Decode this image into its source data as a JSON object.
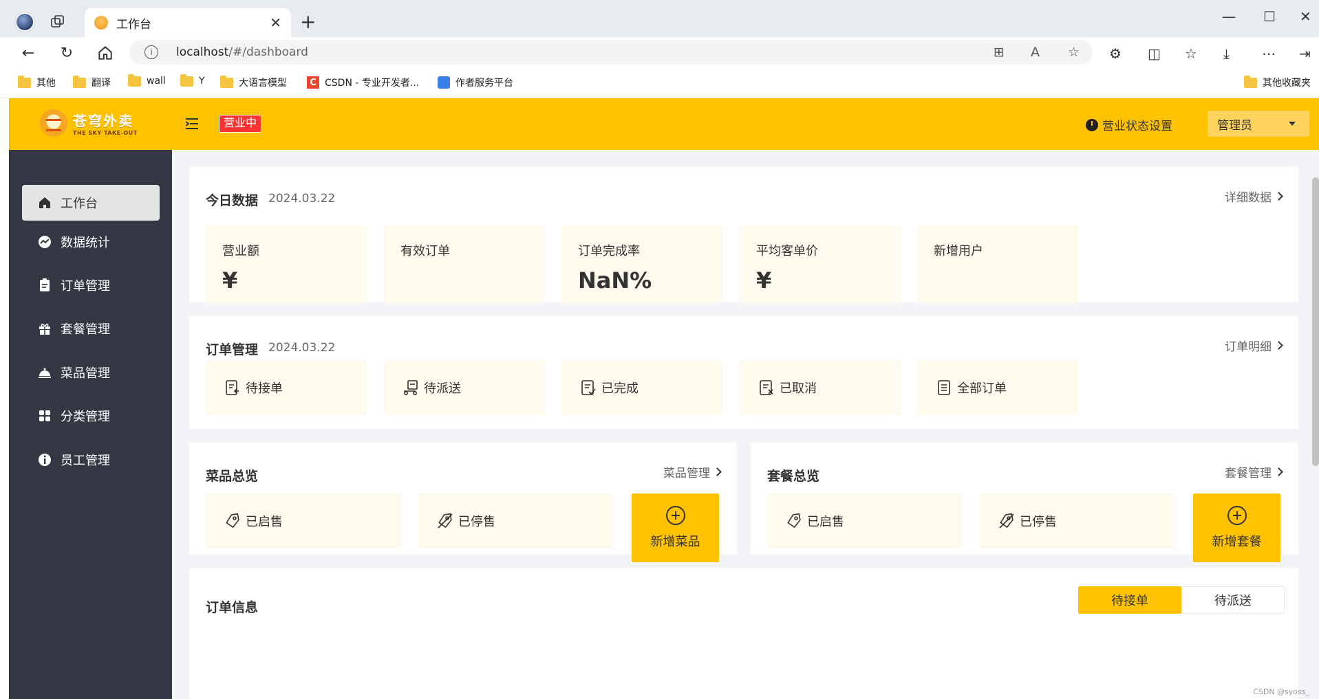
{
  "browser": {
    "tab_title": "工作台",
    "url_host": "localhost",
    "url_path": "/#/dashboard",
    "bookmarks": [
      "其他",
      "翻译",
      "wall",
      "Y",
      "大语言模型",
      "CSDN - 专业开发者...",
      "作者服务平台"
    ],
    "other_bookmarks": "其他收藏夹"
  },
  "header": {
    "logo_cn": "苍穹外卖",
    "logo_en": "THE SKY TAKE-OUT",
    "status_badge": "营业中",
    "status_settings": "营业状态设置",
    "user": "管理员",
    "accent": "#ffc200"
  },
  "sidebar": {
    "items": [
      {
        "label": "工作台",
        "icon": "home-icon"
      },
      {
        "label": "数据统计",
        "icon": "chart-icon"
      },
      {
        "label": "订单管理",
        "icon": "clipboard-icon"
      },
      {
        "label": "套餐管理",
        "icon": "gift-icon"
      },
      {
        "label": "菜品管理",
        "icon": "dish-icon"
      },
      {
        "label": "分类管理",
        "icon": "grid-icon"
      },
      {
        "label": "员工管理",
        "icon": "info-icon"
      }
    ]
  },
  "today": {
    "title": "今日数据",
    "date": "2024.03.22",
    "link": "详细数据",
    "tiles": [
      {
        "label": "营业额",
        "value": "¥"
      },
      {
        "label": "有效订单",
        "value": ""
      },
      {
        "label": "订单完成率",
        "value": "NaN%"
      },
      {
        "label": "平均客单价",
        "value": "¥"
      },
      {
        "label": "新增用户",
        "value": ""
      }
    ]
  },
  "orders": {
    "title": "订单管理",
    "date": "2024.03.22",
    "link": "订单明细",
    "tiles": [
      "待接单",
      "待派送",
      "已完成",
      "已取消",
      "全部订单"
    ]
  },
  "dishes": {
    "title": "菜品总览",
    "link": "菜品管理",
    "on_sale": "已启售",
    "off_sale": "已停售",
    "add": "新增菜品"
  },
  "setmeals": {
    "title": "套餐总览",
    "link": "套餐管理",
    "on_sale": "已启售",
    "off_sale": "已停售",
    "add": "新增套餐"
  },
  "order_info": {
    "title": "订单信息",
    "tabs": [
      "待接单",
      "待派送"
    ]
  },
  "watermark": "CSDN @syoss_"
}
